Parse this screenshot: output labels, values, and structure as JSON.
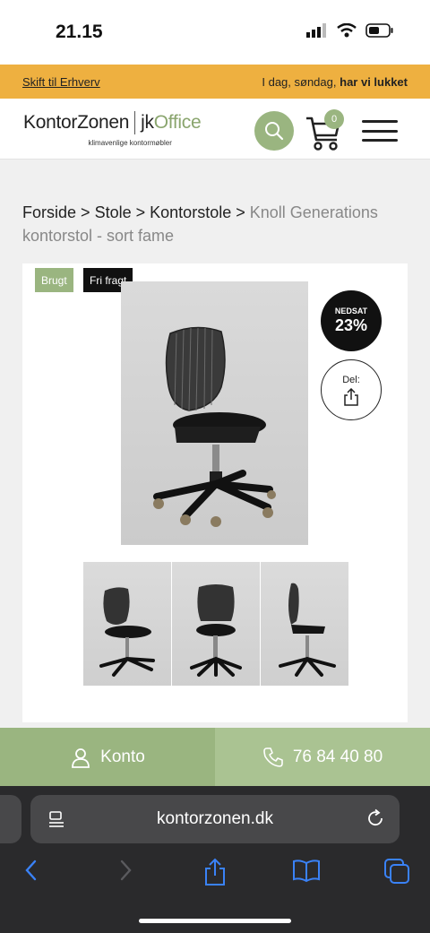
{
  "status_bar": {
    "time": "21.15"
  },
  "promo": {
    "switch_link": "Skift til Erhverv",
    "status_prefix": "I dag, søndag,",
    "status_bold": "har vi lukket"
  },
  "header": {
    "logo_left": "KontorZonen",
    "logo_right_prefix": "jk",
    "logo_right_brand": "Office",
    "tagline": "klimavenlige kontormøbler",
    "cart_count": "0"
  },
  "breadcrumb": {
    "items": [
      "Forside",
      "Stole",
      "Kontorstole"
    ],
    "separator": ">",
    "current": "Knoll Generations kontorstol - sort fame"
  },
  "product": {
    "badge_used": "Brugt",
    "badge_freight": "Fri fragt",
    "discount_label": "NEDSAT",
    "discount_value": "23%",
    "share_label": "Del:",
    "thumbnail_count": 3
  },
  "contact": {
    "account_label": "Konto",
    "phone": "76 84 40 80"
  },
  "browser": {
    "url": "kontorzonen.dk"
  },
  "colors": {
    "promo_bg": "#eeb040",
    "brand_green": "#9ab580",
    "brand_green_light": "#aac392",
    "browser_bg": "#2a2a2c",
    "ios_blue": "#3a82f7"
  }
}
